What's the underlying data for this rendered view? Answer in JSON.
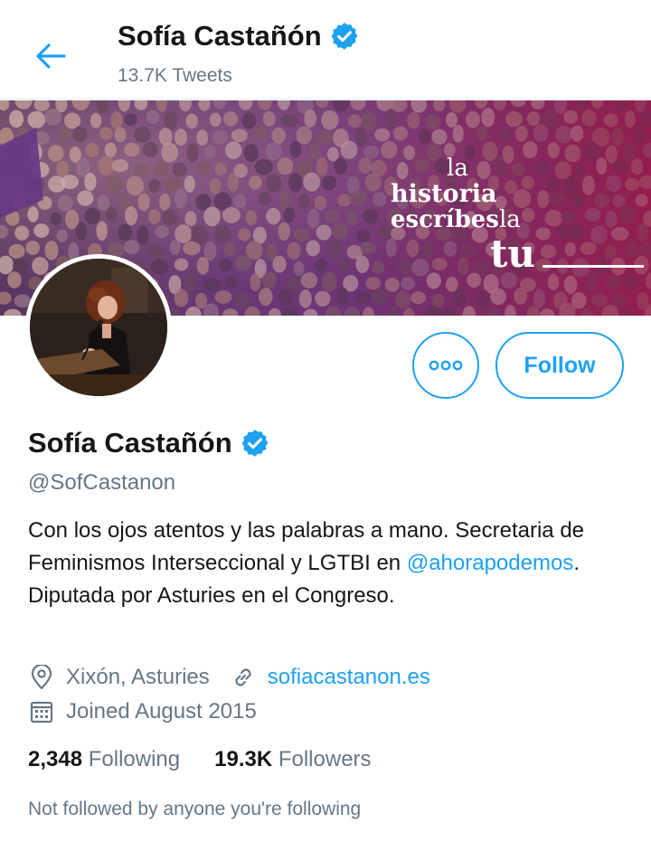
{
  "header": {
    "title": "Sofía Castañón",
    "tweet_count": "13.7K Tweets"
  },
  "banner": {
    "slogan_line1": "la",
    "slogan_line2": "historia",
    "slogan_line3a": "escríbes",
    "slogan_line3b": "la",
    "slogan_line4": "tu"
  },
  "profile": {
    "name": "Sofía Castañón",
    "handle": "@SofCastanon",
    "bio_text_1": "Con los ojos atentos y las palabras a mano. Secretaria de Feminismos Interseccional y LGTBI en ",
    "bio_mention": "@ahorapodemos",
    "bio_text_2": ". Diputada por Asturies en el Congreso.",
    "location": "Xixón, Asturies",
    "website": "sofiacastanon.es",
    "joined": "Joined August 2015",
    "following_count": "2,348",
    "following_label": "Following",
    "followers_count": "19.3K",
    "followers_label": "Followers",
    "not_followed": "Not followed by anyone you're following"
  },
  "actions": {
    "follow_label": "Follow"
  },
  "icons": {
    "back": "arrow-left-icon",
    "verified": "verified-badge-icon",
    "more": "more-options-icon",
    "location": "location-pin-icon",
    "link": "link-icon",
    "calendar": "calendar-icon"
  },
  "colors": {
    "accent": "#1da1f2",
    "text_primary": "#14171a",
    "text_secondary": "#657786"
  }
}
